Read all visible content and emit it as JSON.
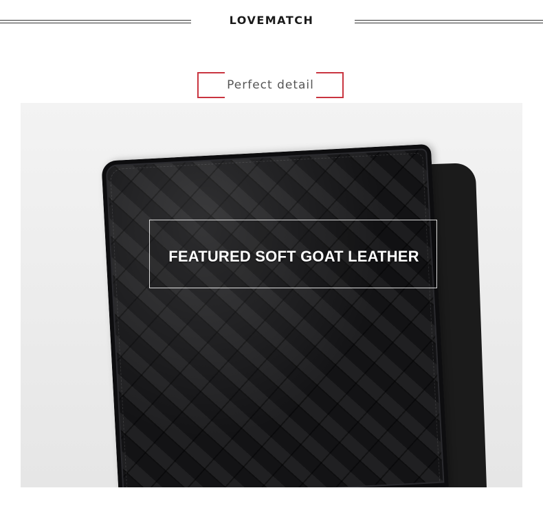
{
  "header": {
    "brand_name": "LOVEMATCH"
  },
  "section": {
    "title": "Perfect detail",
    "accent_color": "#c9343f"
  },
  "product": {
    "image_subject": "wallet-photo",
    "feature_caption": "FEATURED SOFT GOAT LEATHER"
  }
}
